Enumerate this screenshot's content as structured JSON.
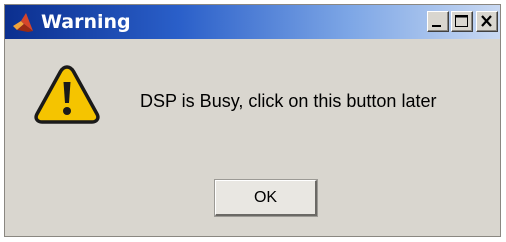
{
  "window": {
    "title": "Warning",
    "app_icon": "matlab-logo-icon",
    "controls": {
      "minimize_icon": "minimize-icon",
      "maximize_icon": "maximize-icon",
      "close_icon": "close-icon"
    },
    "titlebar_color": "#0b2f8f",
    "background_color": "#d9d6cf"
  },
  "dialog": {
    "icon": "warning-icon",
    "icon_color": "#f5c400",
    "message": "DSP is Busy, click on this button later",
    "ok_label": "OK"
  }
}
